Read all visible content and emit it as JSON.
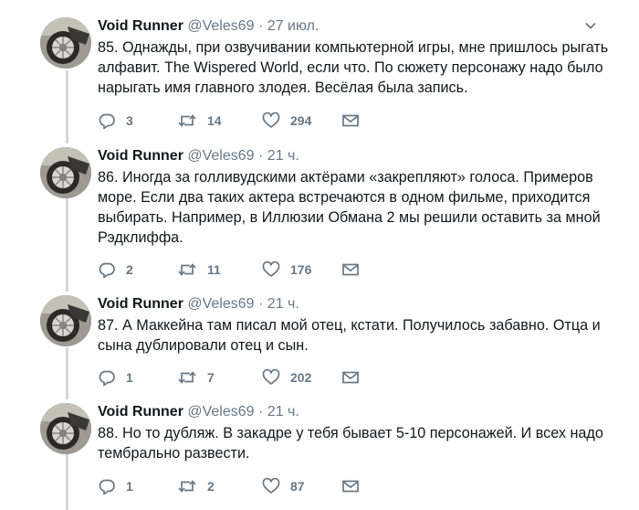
{
  "tweets": [
    {
      "name": "Void Runner",
      "handle": "@Veles69",
      "separator": "·",
      "time": "27 июл.",
      "text": "85. Однажды, при озвучивании компьютерной игры, мне пришлось рыгать алфавит. The Wispered World, если что. По сюжету персонажу надо было нарыгать имя главного злодея. Весёлая была запись.",
      "replies": "3",
      "retweets": "14",
      "likes": "294"
    },
    {
      "name": "Void Runner",
      "handle": "@Veles69",
      "separator": "·",
      "time": "21 ч.",
      "text": "86. Иногда за голливудскими актёрами «закрепляют» голоса. Примеров море. Если два таких актера встречаются в одном фильме, приходится выбирать. Например, в Иллюзии Обмана 2 мы решили оставить за мной Рэдклиффа.",
      "replies": "2",
      "retweets": "11",
      "likes": "176"
    },
    {
      "name": "Void Runner",
      "handle": "@Veles69",
      "separator": "·",
      "time": "21 ч.",
      "text": "87. А Маккейна там писал мой отец, кстати. Получилось забавно. Отца и сына дублировали отец и сын.",
      "replies": "1",
      "retweets": "7",
      "likes": "202"
    },
    {
      "name": "Void Runner",
      "handle": "@Veles69",
      "separator": "·",
      "time": "21 ч.",
      "text": "88. Но то дубляж. В закадре у тебя бывает 5-10 персонажей. И всех надо тембрально развести.",
      "replies": "1",
      "retweets": "2",
      "likes": "87"
    }
  ],
  "icons": {
    "reply": "reply-icon",
    "retweet": "retweet-icon",
    "like": "heart-icon",
    "dm": "envelope-icon",
    "more": "chevron-down-icon"
  },
  "colors": {
    "text": "#14171a",
    "secondary": "#657786",
    "thread_line": "#cfd9de"
  }
}
